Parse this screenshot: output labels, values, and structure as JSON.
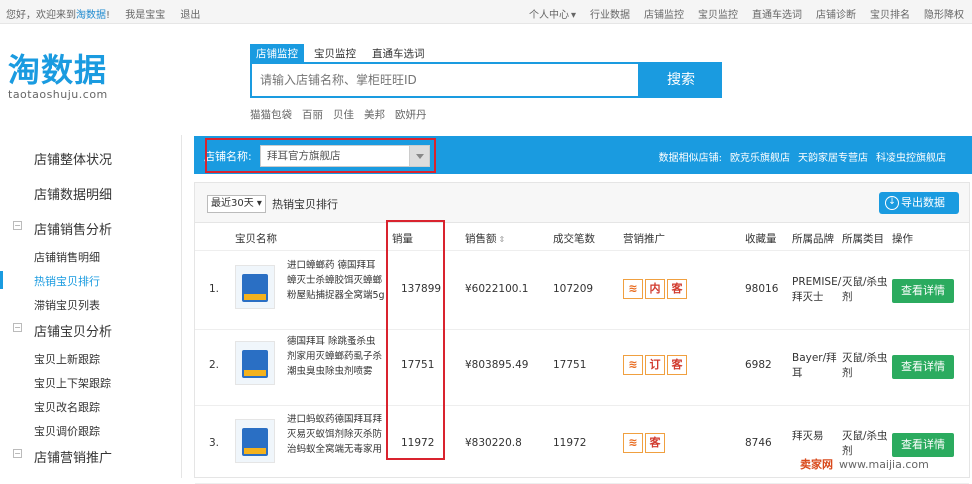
{
  "topbar": {
    "greeting": "您好，欢迎来到",
    "site_link": "淘数据",
    "greeting_end": "!",
    "user": "我是宝宝",
    "logout": "退出",
    "nav": [
      "个人中心",
      "行业数据",
      "店铺监控",
      "宝贝监控",
      "直通车选词",
      "店铺诊断",
      "宝贝排名",
      "隐形降权"
    ]
  },
  "logo": {
    "brand": "淘数据",
    "domain": "taotaoshuju.com"
  },
  "search": {
    "tabs": [
      "店铺监控",
      "宝贝监控",
      "直通车选词"
    ],
    "active_tab": 0,
    "placeholder": "请输入店铺名称、掌柜旺旺ID",
    "button": "搜索",
    "hotwords": [
      "猫猫包袋",
      "百丽",
      "贝佳",
      "美邦",
      "欧妍丹"
    ]
  },
  "sidebar": {
    "items": [
      {
        "label": "店铺整体状况",
        "type": "big"
      },
      {
        "label": "店铺数据明细",
        "type": "big"
      },
      {
        "label": "店铺销售分析",
        "type": "group"
      },
      {
        "label": "店铺销售明细",
        "type": "sub"
      },
      {
        "label": "热销宝贝排行",
        "type": "sub",
        "active": true
      },
      {
        "label": "滞销宝贝列表",
        "type": "sub"
      },
      {
        "label": "店铺宝贝分析",
        "type": "group"
      },
      {
        "label": "宝贝上新跟踪",
        "type": "sub"
      },
      {
        "label": "宝贝上下架跟踪",
        "type": "sub"
      },
      {
        "label": "宝贝改名跟踪",
        "type": "sub"
      },
      {
        "label": "宝贝调价跟踪",
        "type": "sub"
      },
      {
        "label": "店铺营销推广",
        "type": "group"
      }
    ]
  },
  "shopbar": {
    "label": "店铺名称:",
    "selected_shop": "拜耳官方旗舰店",
    "similar_label": "数据相似店铺:",
    "similar_shops": [
      "欧克乐旗舰店",
      "天韵家居专营店",
      "科凌虫控旗舰店"
    ]
  },
  "panel": {
    "range": "最近30天",
    "title": "热销宝贝排行",
    "export": "导出数据",
    "columns": [
      "宝贝名称",
      "销量",
      "销售额",
      "成交笔数",
      "营销推广",
      "收藏量",
      "所属品牌",
      "所属类目",
      "操作"
    ],
    "sort_mark": "⇕",
    "detail_label": "查看详情",
    "rows": [
      {
        "rank": "1.",
        "title": "进口蟑螂药 德国拜耳蟑灭士杀蟑胶饵灭蟑螂粉屋贴捕捉器全窝端5g",
        "sales": "137899",
        "revenue": "¥6022100.1",
        "orders": "107209",
        "promos": [
          "内",
          "客"
        ],
        "favorites": "98016",
        "brand": "PREMISE/拜灭士",
        "category": "灭鼠/杀虫剂"
      },
      {
        "rank": "2.",
        "title": "德国拜耳 除跳蚤杀虫剂家用灭蟑螂药虱子杀潮虫臭虫除虫剂喷雾",
        "sales": "17751",
        "revenue": "¥803895.49",
        "orders": "17751",
        "promos": [
          "订",
          "客"
        ],
        "favorites": "6982",
        "brand": "Bayer/拜耳",
        "category": "灭鼠/杀虫剂"
      },
      {
        "rank": "3.",
        "title": "进口蚂蚁药德国拜耳拜灭易灭蚁饵剂除灭杀防治蚂蚁全窝端无毒家用",
        "sales": "11972",
        "revenue": "¥830220.8",
        "orders": "11972",
        "promos": [
          "客"
        ],
        "favorites": "8746",
        "brand": "拜灭易",
        "category": "灭鼠/杀虫剂"
      }
    ]
  },
  "watermark": {
    "brand": "卖家网",
    "url": "www.maijia.com"
  }
}
